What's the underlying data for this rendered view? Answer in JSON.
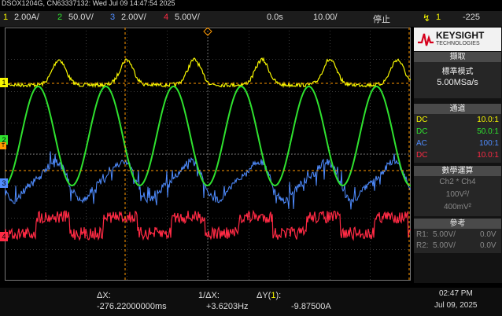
{
  "title": "DSOX1204G, CN63337132: Wed Jul 09 14:47:54 2025",
  "status": {
    "ch1_num": "1",
    "ch1_scale": "2.00A/",
    "ch2_num": "2",
    "ch2_scale": "50.0V/",
    "ch3_num": "3",
    "ch3_scale": "2.00V/",
    "ch4_num": "4",
    "ch4_scale": "5.00V/",
    "time_delay": "0.0s",
    "time_scale": "10.00/",
    "run_state": "停止",
    "trigger_source": "1",
    "trigger_level": "-225"
  },
  "markers": {
    "ch1": "1",
    "ch2": "2",
    "ch3": "3",
    "ch4": "4",
    "trig_level": "T"
  },
  "panel": {
    "brand": "KEYSIGHT",
    "brand_sub": "TECHNOLOGIES",
    "acquire_header": "擷取",
    "acquire_mode": "標準模式",
    "sample_rate": "5.00MSa/s",
    "channels_header": "通道",
    "channels": [
      {
        "coupling": "DC",
        "probe": "10.0:1",
        "color": "#f7f700"
      },
      {
        "coupling": "DC",
        "probe": "50.0:1",
        "color": "#2fe22f"
      },
      {
        "coupling": "AC",
        "probe": "100:1",
        "color": "#4f8cff"
      },
      {
        "coupling": "DC",
        "probe": "10.0:1",
        "color": "#ff2a44"
      }
    ],
    "math_header": "數學運算",
    "math_expr": "Ch2 * Ch4",
    "math_scale": "100V²/",
    "math_offset": "400mV²",
    "ref_header": "參考",
    "refs": [
      {
        "name": "R1:",
        "scale": "5.00V/",
        "offset": "0.0V"
      },
      {
        "name": "R2:",
        "scale": "5.00V/",
        "offset": "0.0V"
      }
    ]
  },
  "measurements": {
    "dx_label": "ΔX:",
    "dx_value": "-276.22000000ms",
    "inv_dx_label": "1/ΔX:",
    "inv_dx_value": "+3.6203Hz",
    "dy_label": "ΔY(",
    "dy_channel": "1",
    "dy_label_end": "):",
    "dy_value": "-9.87500A"
  },
  "clock": {
    "time": "02:47 PM",
    "date": "Jul 09, 2025"
  },
  "colors": {
    "ch1": "#f7f700",
    "ch2": "#2fe22f",
    "ch3": "#4f8cff",
    "ch4": "#ff2a44",
    "cursor": "#ff9900",
    "trigger": "#ff9900"
  }
}
